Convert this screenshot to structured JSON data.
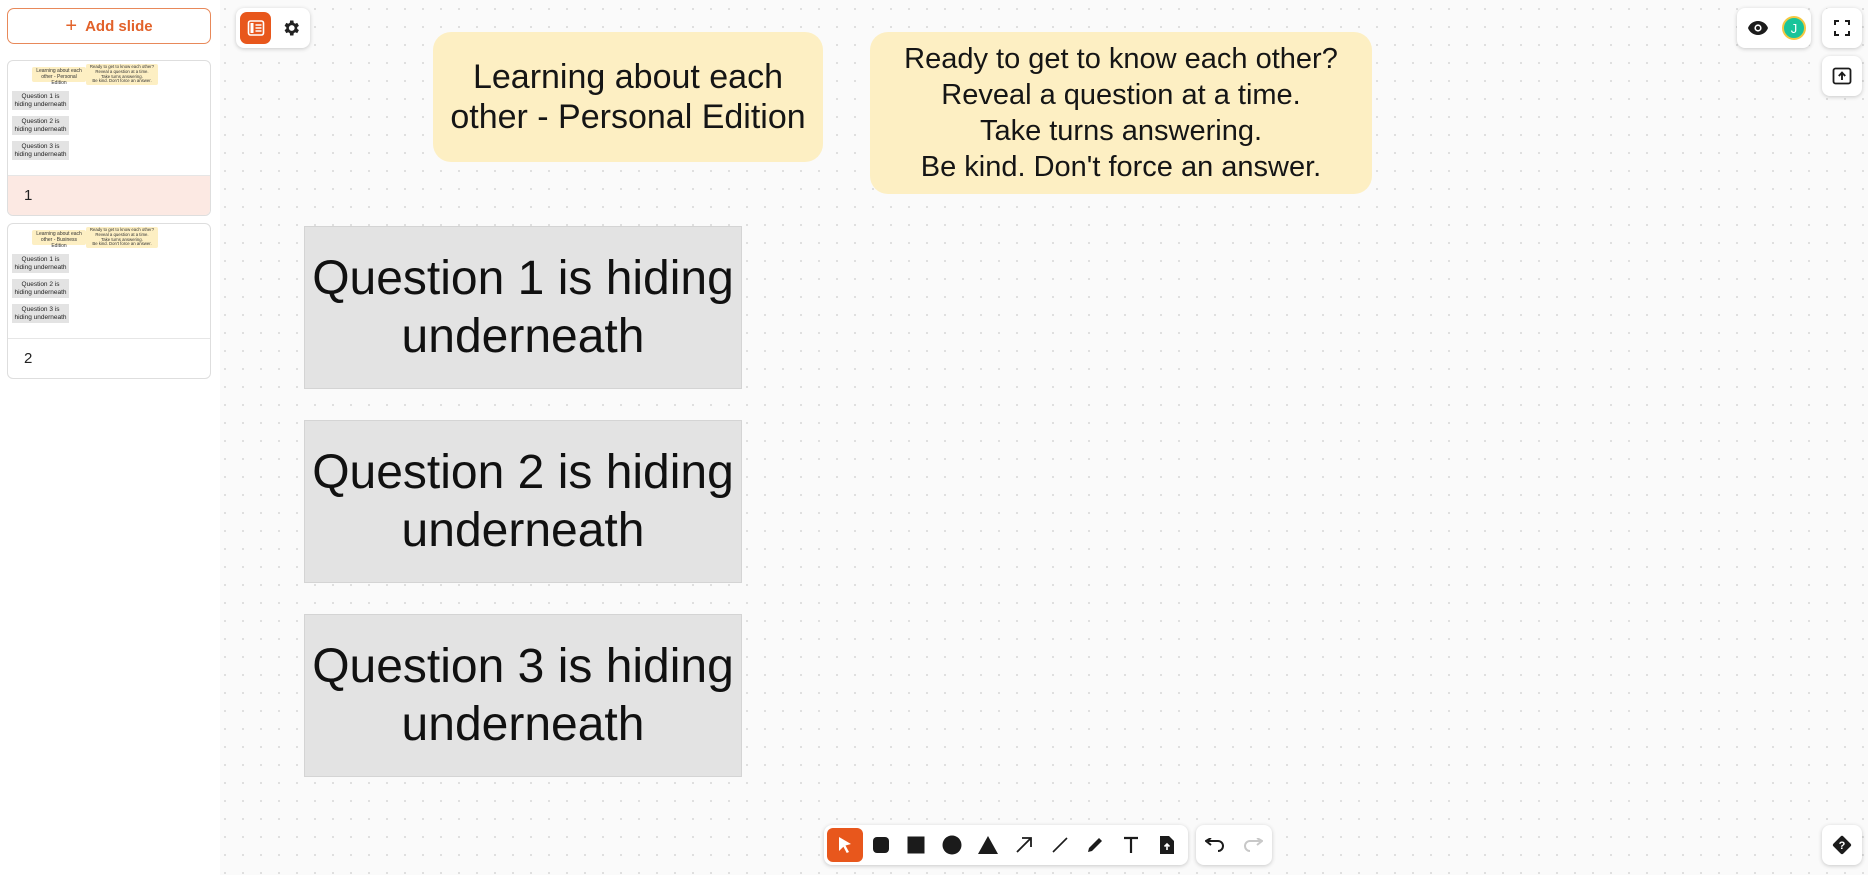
{
  "sidebar": {
    "add_slide_label": "Add slide",
    "slides": [
      {
        "number": "1",
        "title_lines": [
          "Learning about each",
          "other - Personal Edition"
        ],
        "note_lines": [
          "Ready to get to know each other?",
          "Reveal a question at a time.",
          "Take turns answering.",
          "Be kind. Don't force an answer."
        ],
        "questions": [
          "Question 1 is hiding underneath",
          "Question 2 is hiding underneath",
          "Question 3 is hiding underneath"
        ]
      },
      {
        "number": "2",
        "title_lines": [
          "Learning about each",
          "other - Business Edition"
        ],
        "note_lines": [
          "Ready to get to know each other?",
          "Reveal a question at a time.",
          "Take turns answering.",
          "Be kind. Don't force an answer."
        ],
        "questions": [
          "Question 1 is hiding underneath",
          "Question 2 is hiding underneath",
          "Question 3 is hiding underneath"
        ]
      }
    ]
  },
  "canvas": {
    "title_sticky": "Learning about each other - Personal Edition",
    "instructions": [
      "Ready to get to know each other?",
      "Reveal a question at a time.",
      "Take turns answering.",
      "Be kind. Don't force an answer."
    ],
    "questions": [
      "Question 1 is hiding underneath",
      "Question 2 is hiding underneath",
      "Question 3 is hiding underneath"
    ]
  },
  "user": {
    "avatar_initial": "J"
  },
  "tools": [
    "select",
    "rounded-rectangle",
    "rectangle",
    "circle",
    "triangle",
    "arrow",
    "line",
    "pen",
    "text",
    "file-upload"
  ],
  "colors": {
    "accent": "#e8571c",
    "sticky": "#fdefc3",
    "question_card": "#e3e3e3",
    "active_slide": "#fce9e3",
    "avatar": "#19c49a"
  }
}
